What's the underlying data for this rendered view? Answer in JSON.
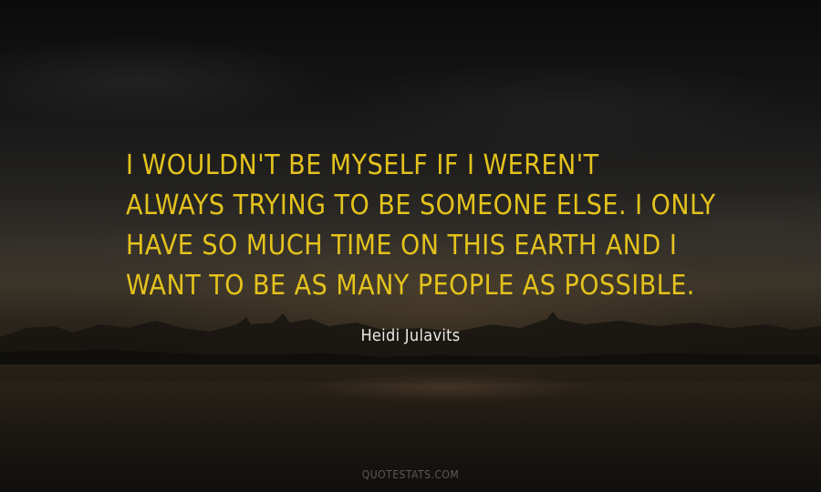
{
  "quote": {
    "lines": [
      "I wouldn't be myself if I weren't",
      "always trying to be someone else. I only",
      "have so much time on this earth and I",
      "want to be as many people as possible."
    ]
  },
  "author": "Heidi Julavits",
  "watermark": "QUOTESTATS.COM",
  "colors": {
    "quote_text": "#e4c21d",
    "author_text": "#e8e8e6",
    "watermark_text": "#5c5a57"
  }
}
